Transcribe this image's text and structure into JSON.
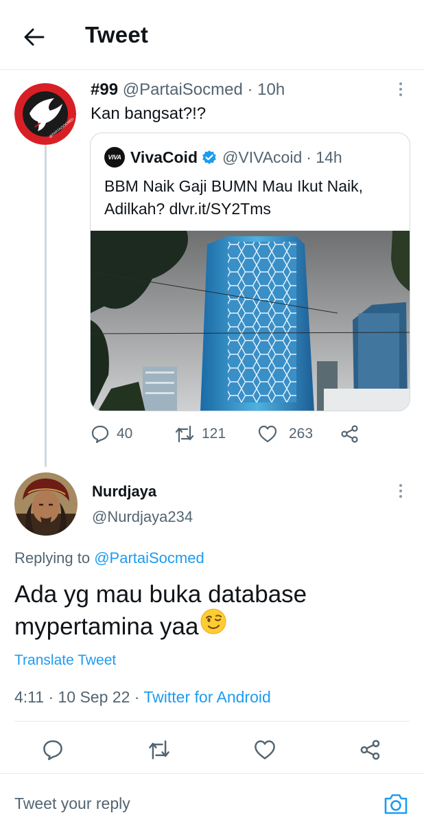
{
  "header": {
    "title": "Tweet"
  },
  "parent_tweet": {
    "display_name": "#99",
    "handle": "@PartaiSocmed",
    "time": "· 10h",
    "text": "Kan bangsat?!?",
    "avatar_logo_text": "@PARTAISOCMED",
    "quoted": {
      "logo_text": "VIVA",
      "name": "VivaCoid",
      "handle": "@VIVAcoid",
      "time": "· 14h",
      "text": "BBM Naik Gaji BUMN Mau Ikut Naik, Adilkah? dlvr.it/SY2Tms"
    },
    "stats": {
      "replies": "40",
      "retweets": "121",
      "likes": "263"
    }
  },
  "main_tweet": {
    "display_name": "Nurdjaya",
    "handle": "@Nurdjaya234",
    "replying_prefix": "Replying to",
    "replying_handle": "@PartaiSocmed",
    "text": "Ada yg mau buka database mypertamina yaa",
    "translate_label": "Translate Tweet",
    "time_date": "4:11 · 10 Sep 22 · ",
    "source": "Twitter for Android"
  },
  "reply_box": {
    "placeholder": "Tweet your reply"
  },
  "icons": {
    "back": "arrow-left-icon",
    "more": "more-vertical-icon",
    "verified": "verified-badge-icon",
    "reply": "reply-icon",
    "retweet": "retweet-icon",
    "like": "heart-icon",
    "share": "share-icon",
    "camera": "camera-icon",
    "emoji": "winking-face-emoji"
  },
  "colors": {
    "accent": "#1d9bf0",
    "text": "#0f1419",
    "muted": "#536471",
    "border": "#cfd9de"
  }
}
